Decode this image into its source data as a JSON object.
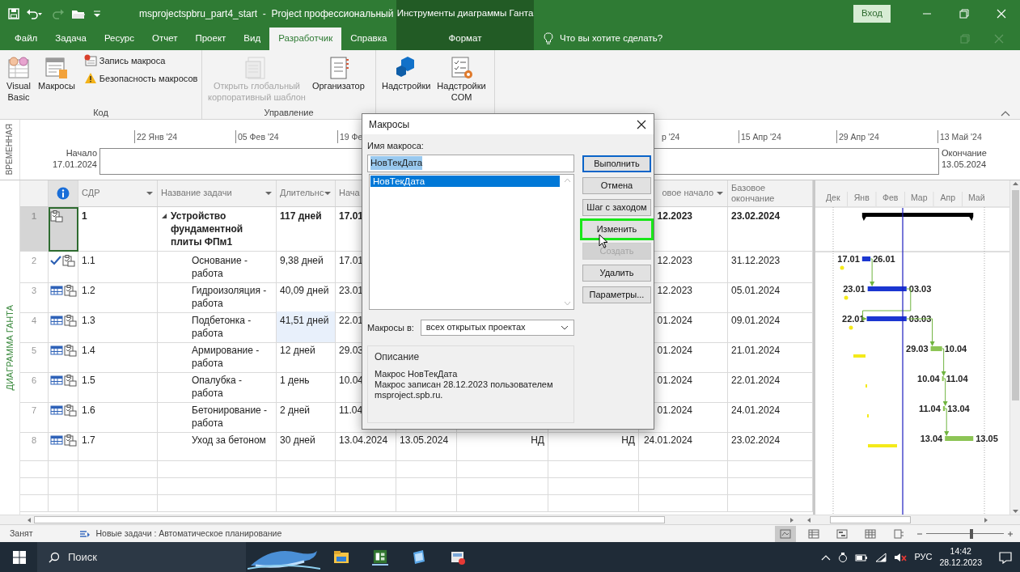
{
  "title_bar": {
    "title": "msprojectspbru_part4_start  -  Project профессиональный",
    "sign_in": "Вход"
  },
  "tabs": [
    {
      "label": "Файл",
      "selected": false
    },
    {
      "label": "Задача",
      "selected": false
    },
    {
      "label": "Ресурс",
      "selected": false
    },
    {
      "label": "Отчет",
      "selected": false
    },
    {
      "label": "Проект",
      "selected": false
    },
    {
      "label": "Вид",
      "selected": false
    },
    {
      "label": "Разработчик",
      "selected": true
    },
    {
      "label": "Справка",
      "selected": false
    }
  ],
  "context_group": {
    "title": "Инструменты диаграммы Ганта",
    "tabs": [
      {
        "label": "Формат",
        "selected": false
      }
    ]
  },
  "tell_me": "Что вы хотите сделать?",
  "ribbon": {
    "groups": [
      {
        "label": "Код",
        "items": [
          {
            "kind": "large",
            "label": "Visual\nBasic",
            "disabled": false
          },
          {
            "kind": "large",
            "label": "Макросы",
            "disabled": false
          },
          {
            "kind": "small",
            "label": "Запись макроса",
            "disabled": false
          },
          {
            "kind": "small",
            "label": "Безопасность макросов",
            "disabled": false
          }
        ]
      },
      {
        "label": "Управление",
        "items": [
          {
            "kind": "large",
            "label": "Открыть глобальный\nкорпоративный шаблон",
            "disabled": true
          },
          {
            "kind": "large",
            "label": "Организатор",
            "disabled": false
          }
        ]
      },
      {
        "items": [
          {
            "kind": "large",
            "label": "Надстройки",
            "disabled": false
          },
          {
            "kind": "large",
            "label": "Надстройки\nCOM",
            "disabled": false
          }
        ]
      }
    ]
  },
  "timeline": {
    "side_label": "ВРЕМЕННАЯ",
    "start_label": "Начало",
    "start_date": "17.01.2024",
    "ticks": [
      "22 Янв '24",
      "05 Фев '24",
      "19 Фе",
      "р '24",
      "15 Апр '24",
      "29 Апр '24",
      "13 Май '24"
    ],
    "end_label": "Окончание",
    "end_date": "13.05.2024"
  },
  "view_label": "ДИАГРАММА ГАНТА",
  "table": {
    "columns": [
      {
        "label": "СДР",
        "dropdown": true
      },
      {
        "label": "Название задачи",
        "dropdown": true
      },
      {
        "label": "Длительнс",
        "dropdown": true
      },
      {
        "label": "Нача",
        "dropdown": false
      },
      {
        "label": "овое начало",
        "dropdown": true
      },
      {
        "label": "Базовое окончание",
        "dropdown": false
      }
    ],
    "rows": [
      {
        "num": "1",
        "completed": false,
        "constrained": false,
        "wbs": "1",
        "name": "Устройство фундаментной плиты ФПм1",
        "summary": true,
        "selected": true,
        "duration": "117 дней",
        "duration_highlighted": false,
        "start": "17.01",
        "baseline_start": "12.2023",
        "baseline_finish": "23.02.2024",
        "children": [
          {
            "num": "2",
            "completed": true,
            "constrained": false,
            "wbs": "1.1",
            "name": "Основание - работа",
            "summary": false,
            "selected": false,
            "duration": "9,38 дней",
            "duration_highlighted": false,
            "start": "17.01",
            "baseline_start": "12.2023",
            "baseline_finish": "31.12.2023",
            "bar": {
              "start": "17.01",
              "end": "26.01",
              "color": "#1b36d1"
            }
          },
          {
            "num": "3",
            "completed": false,
            "constrained": true,
            "wbs": "1.2",
            "name": "Гидроизоляция - работа",
            "summary": false,
            "selected": false,
            "duration": "40,09 дней",
            "duration_highlighted": false,
            "start": "23.01",
            "baseline_start": "12.2023",
            "baseline_finish": "05.01.2024",
            "bar": {
              "start": "23.01",
              "end": "03.03",
              "color": "#1b36d1"
            }
          },
          {
            "num": "4",
            "completed": false,
            "constrained": true,
            "wbs": "1.3",
            "name": "Подбетонка - работа",
            "summary": false,
            "selected": false,
            "duration": "41,51 дней",
            "duration_highlighted": true,
            "start": "22.01",
            "baseline_start": "01.2024",
            "baseline_finish": "09.01.2024",
            "bar": {
              "start": "22.01",
              "end": "03.03",
              "color": "#1b36d1"
            }
          },
          {
            "num": "5",
            "completed": false,
            "constrained": true,
            "wbs": "1.4",
            "name": "Армирование - работа",
            "summary": false,
            "selected": false,
            "duration": "12 дней",
            "duration_highlighted": false,
            "start": "29.03",
            "baseline_start": "01.2024",
            "baseline_finish": "21.01.2024",
            "bar": {
              "start": "29.03",
              "end": "10.04",
              "color": "#8dc556"
            }
          },
          {
            "num": "6",
            "completed": false,
            "constrained": true,
            "wbs": "1.5",
            "name": "Опалубка - работа",
            "summary": false,
            "selected": false,
            "duration": "1 день",
            "duration_highlighted": false,
            "start": "10.04",
            "baseline_start": "01.2024",
            "baseline_finish": "22.01.2024",
            "bar": {
              "start": "10.04",
              "end": "11.04",
              "color": "#8dc556"
            }
          },
          {
            "num": "7",
            "completed": false,
            "constrained": true,
            "wbs": "1.6",
            "name": "Бетонирование - работа",
            "summary": false,
            "selected": false,
            "duration": "2 дней",
            "duration_highlighted": false,
            "start": "11.04",
            "baseline_start": "01.2024",
            "baseline_finish": "24.01.2024",
            "bar": {
              "start": "11.04",
              "end": "13.04",
              "color": "#8dc556"
            }
          },
          {
            "num": "8",
            "completed": false,
            "constrained": true,
            "wbs": "1.7",
            "name": "Уход за бетоном",
            "summary": false,
            "selected": false,
            "duration": "30 дней",
            "duration_highlighted": false,
            "start": "13.04.2024",
            "finish": "13.05.2024",
            "column_8": "НД",
            "column_9": "НД",
            "baseline_start": "24.01.2024",
            "baseline_finish": "23.02.2024",
            "bar": {
              "start": "13.04",
              "end": "13.05",
              "color": "#8dc556"
            }
          }
        ]
      }
    ]
  },
  "gantt": {
    "months": [
      "Дек",
      "Янв",
      "Фев",
      "Мар",
      "Апр",
      "Май"
    ]
  },
  "dialog": {
    "title": "Макросы",
    "name_label": "Имя макроса:",
    "name_value": "НовТекДата",
    "name_selected": true,
    "macros": [
      {
        "label": "НовТекДата",
        "selected": true
      }
    ],
    "location_label": "Макросы в:",
    "location_value": "всех открытых проектах",
    "description_title": "Описание",
    "description": "Макрос НовТекДата\nМакрос записан 28.12.2023 пользователем\nmsproject.spb.ru.",
    "buttons": [
      {
        "label": "Выполнить",
        "default": true,
        "disabled": false,
        "highlighted": false
      },
      {
        "label": "Отмена",
        "default": false,
        "disabled": false,
        "highlighted": false
      },
      {
        "label": "Шаг с заходом",
        "default": false,
        "disabled": false,
        "highlighted": false
      },
      {
        "label": "Изменить",
        "default": false,
        "disabled": false,
        "highlighted": true
      },
      {
        "label": "Создать",
        "default": false,
        "disabled": true,
        "highlighted": false
      },
      {
        "label": "Удалить",
        "default": false,
        "disabled": false,
        "highlighted": false
      },
      {
        "label": "Параметры...",
        "default": false,
        "disabled": false,
        "highlighted": false
      }
    ]
  },
  "status_bar": {
    "mode": "Занят",
    "task_mode": "Новые задачи : Автоматическое планирование",
    "views": [
      {
        "selected": true
      },
      {
        "selected": false
      },
      {
        "selected": false
      },
      {
        "selected": false
      },
      {
        "selected": false
      }
    ],
    "zoom": {
      "level": 0.58
    }
  },
  "taskbar": {
    "search_placeholder": "Поиск",
    "language": "РУС",
    "time": "14:42",
    "date": "28.12.2023"
  }
}
